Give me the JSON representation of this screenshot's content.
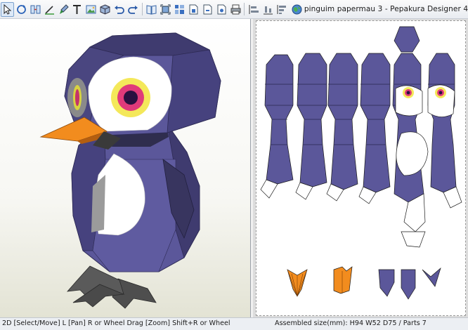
{
  "window": {
    "title": "pinguim papermau 3 - Pepakura Designer 4",
    "app_icon": "pepakura-globe-icon"
  },
  "toolbar": {
    "tools": [
      {
        "name": "select-tool",
        "icon": "cursor-icon",
        "active": true
      },
      {
        "name": "rotate-tool",
        "icon": "rotate-icon"
      },
      {
        "name": "join-tool",
        "icon": "join-icon"
      },
      {
        "name": "draw-line-tool",
        "icon": "line-icon"
      },
      {
        "name": "paint-tool",
        "icon": "brush-icon"
      },
      {
        "name": "text-tool",
        "icon": "text-icon"
      },
      {
        "name": "image-tool",
        "icon": "image-icon"
      },
      {
        "name": "pack-tool",
        "icon": "cube-icon"
      },
      {
        "name": "undo",
        "icon": "undo-icon"
      },
      {
        "name": "redo",
        "icon": "redo-icon"
      },
      {
        "name": "open-book",
        "icon": "book-icon"
      },
      {
        "name": "scan",
        "icon": "scan-icon"
      },
      {
        "name": "layout",
        "icon": "grid-icon"
      },
      {
        "name": "page-a",
        "icon": "page-icon"
      },
      {
        "name": "page-b",
        "icon": "page-icon"
      },
      {
        "name": "page-c",
        "icon": "page-icon"
      },
      {
        "name": "print",
        "icon": "printer-icon"
      },
      {
        "name": "align-a",
        "icon": "align-icon"
      },
      {
        "name": "align-b",
        "icon": "align-icon"
      },
      {
        "name": "align-c",
        "icon": "align-icon"
      }
    ]
  },
  "colors": {
    "body_purple": "#5b579a",
    "body_dark": "#3f3b6f",
    "beak_orange": "#f28c1e",
    "eye_yellow": "#f4e85a",
    "eye_pink": "#e03a7a",
    "feet_gray": "#5a5a5a"
  },
  "status": {
    "hint": "2D [Select/Move] L [Pan] R or Wheel Drag [Zoom] Shift+R or Wheel",
    "info": "Assembled size(mm): H94 W52 D75 / Parts 7"
  }
}
